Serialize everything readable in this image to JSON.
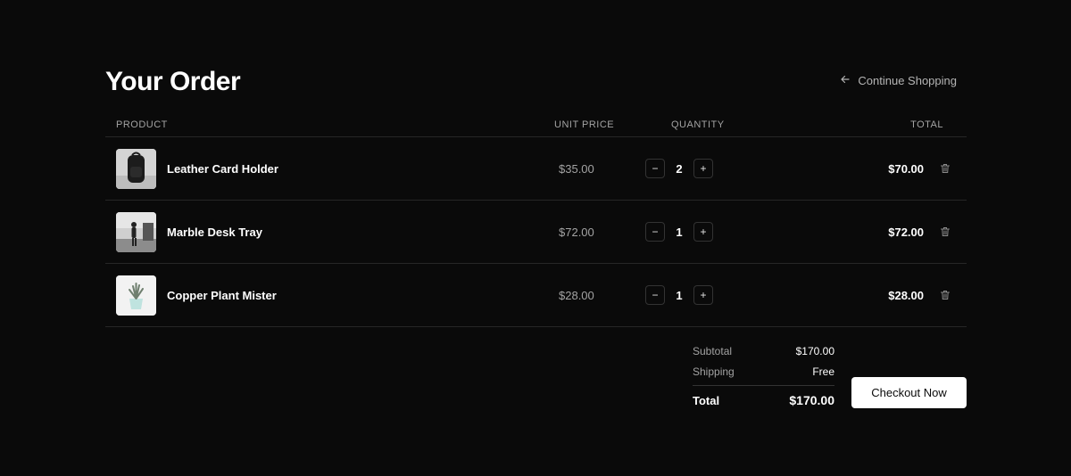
{
  "header": {
    "title": "Your Order",
    "continue_label": "Continue Shopping"
  },
  "table": {
    "columns": {
      "product": "PRODUCT",
      "unit_price": "UNIT PRICE",
      "quantity": "QUANTITY",
      "total": "TOTAL"
    },
    "rows": [
      {
        "name": "Leather Card Holder",
        "unit_price": "$35.00",
        "quantity": "2",
        "total": "$70.00",
        "thumb_icon": "backpack-photo"
      },
      {
        "name": "Marble Desk Tray",
        "unit_price": "$72.00",
        "quantity": "1",
        "total": "$72.00",
        "thumb_icon": "person-photo"
      },
      {
        "name": "Copper Plant Mister",
        "unit_price": "$28.00",
        "quantity": "1",
        "total": "$28.00",
        "thumb_icon": "plant-photo"
      }
    ],
    "decrement_symbol": "−",
    "increment_symbol": "+"
  },
  "summary": {
    "subtotal_label": "Subtotal",
    "subtotal_value": "$170.00",
    "shipping_label": "Shipping",
    "shipping_value": "Free",
    "total_label": "Total",
    "total_value": "$170.00"
  },
  "checkout": {
    "label": "Checkout Now"
  },
  "colors": {
    "background": "#0a0a0a",
    "text": "#ffffff",
    "muted": "#a3a3a3",
    "divider": "#262626",
    "button_bg": "#ffffff"
  }
}
